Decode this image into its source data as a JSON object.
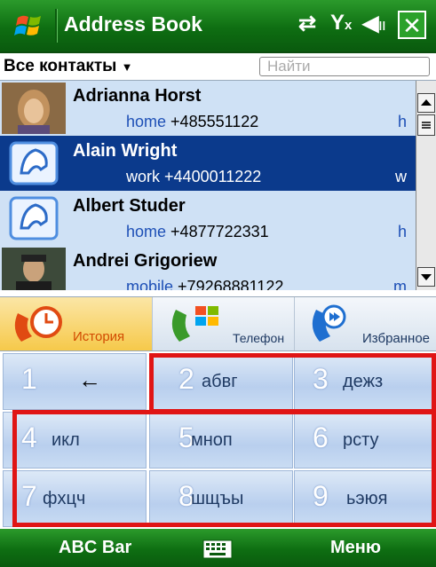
{
  "title_bar": {
    "title": "Address Book",
    "icons": [
      "windows-start-icon",
      "connectivity-icon",
      "signal-off-icon",
      "volume-off-icon",
      "close-icon"
    ],
    "close_label": "✕"
  },
  "filter": {
    "label": "Все контакты",
    "search_placeholder": "Найти"
  },
  "contacts": [
    {
      "name": "Adrianna Horst",
      "type": "home",
      "number": "+485551122",
      "tag": "h",
      "avatar": "photo"
    },
    {
      "name": "Alain Wright",
      "type": "work",
      "number": "+4400011222",
      "tag": "w",
      "avatar": "default",
      "selected": true
    },
    {
      "name": "Albert Studer",
      "type": "home",
      "number": "+4877722331",
      "tag": "h",
      "avatar": "default"
    },
    {
      "name": "Andrei Grigoriew",
      "type": "mobile",
      "number": "+79268881122",
      "tag": "m",
      "avatar": "photo"
    }
  ],
  "tabs": [
    {
      "label": "История",
      "icon": "history-icon"
    },
    {
      "label": "Телефон",
      "icon": "phone-icon"
    },
    {
      "label": "Избранное",
      "icon": "favorites-icon"
    }
  ],
  "keypad": [
    {
      "digit": "1",
      "letters": "←"
    },
    {
      "digit": "2",
      "letters": "абвг"
    },
    {
      "digit": "3",
      "letters": "дежз"
    },
    {
      "digit": "4",
      "letters": "икл"
    },
    {
      "digit": "5",
      "letters": "мноп"
    },
    {
      "digit": "6",
      "letters": "рсту"
    },
    {
      "digit": "7",
      "letters": "фхцч"
    },
    {
      "digit": "8",
      "letters": "шщъы"
    },
    {
      "digit": "9",
      "letters": "ьэюя"
    }
  ],
  "softkeys": {
    "left": "ABC Bar",
    "right": "Меню"
  },
  "colors": {
    "title_green": "#0e6e12",
    "selected_row": "#0b3a8c",
    "row_bg": "#cfe1f5",
    "highlight_red": "#e01515"
  }
}
